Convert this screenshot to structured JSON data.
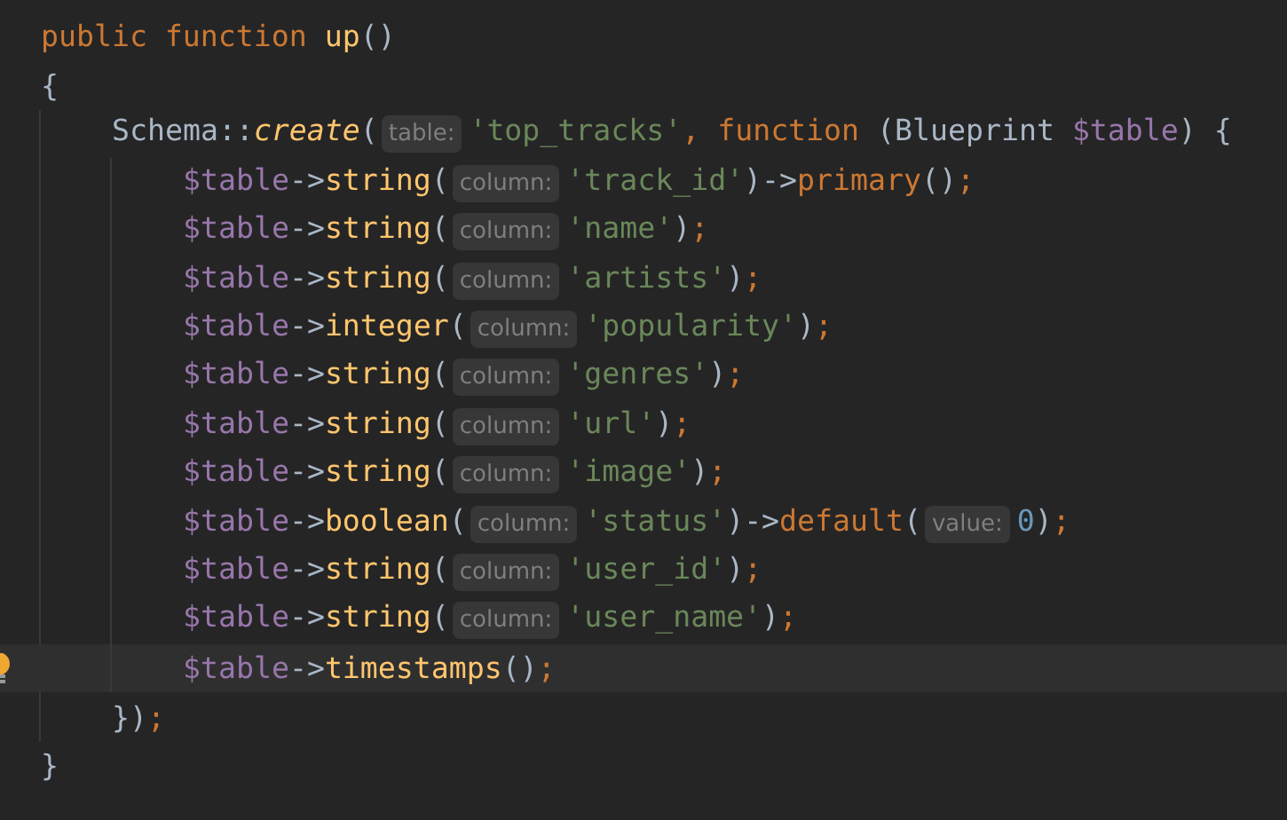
{
  "editor": {
    "lines": [
      {
        "current": false,
        "tokens": [
          {
            "kind": "keyword",
            "text": "public function"
          },
          {
            "kind": "function",
            "text": "up"
          },
          {
            "kind": "punct",
            "text": "()"
          }
        ]
      },
      {
        "current": false,
        "tokens": [
          {
            "kind": "punct",
            "text": "{"
          }
        ],
        "children": [
          {
            "current": false,
            "tokens": [
              {
                "kind": "class",
                "text": "Schema::"
              },
              {
                "kind": "static",
                "text": "create"
              },
              {
                "kind": "punct",
                "text": "("
              },
              {
                "kind": "hint",
                "text": "table:"
              },
              {
                "kind": "string",
                "text": "'top_tracks'"
              },
              {
                "kind": "separator",
                "text": ","
              },
              {
                "kind": "keyword",
                "text": "function"
              },
              {
                "kind": "punct",
                "text": "(Blueprint"
              },
              {
                "kind": "variable",
                "text": "$table"
              },
              {
                "kind": "punct",
                "text": ") {"
              }
            ],
            "children": [
              {
                "current": false,
                "tokens": [
                  {
                    "kind": "variable",
                    "text": "$table"
                  },
                  {
                    "kind": "arrow",
                    "text": "->"
                  },
                  {
                    "kind": "method",
                    "text": "string"
                  },
                  {
                    "kind": "punct",
                    "text": "("
                  },
                  {
                    "kind": "hint",
                    "text": "column:"
                  },
                  {
                    "kind": "string",
                    "text": "'track_id'"
                  },
                  {
                    "kind": "punct",
                    "text": ")"
                  },
                  {
                    "kind": "arrow",
                    "text": "->"
                  },
                  {
                    "kind": "chained",
                    "text": "primary"
                  },
                  {
                    "kind": "punct",
                    "text": "()"
                  },
                  {
                    "kind": "separator",
                    "text": ";"
                  }
                ]
              },
              {
                "current": false,
                "tokens": [
                  {
                    "kind": "variable",
                    "text": "$table"
                  },
                  {
                    "kind": "arrow",
                    "text": "->"
                  },
                  {
                    "kind": "method",
                    "text": "string"
                  },
                  {
                    "kind": "punct",
                    "text": "("
                  },
                  {
                    "kind": "hint",
                    "text": "column:"
                  },
                  {
                    "kind": "string",
                    "text": "'name'"
                  },
                  {
                    "kind": "punct",
                    "text": ")"
                  },
                  {
                    "kind": "separator",
                    "text": ";"
                  }
                ]
              },
              {
                "current": false,
                "tokens": [
                  {
                    "kind": "variable",
                    "text": "$table"
                  },
                  {
                    "kind": "arrow",
                    "text": "->"
                  },
                  {
                    "kind": "method",
                    "text": "string"
                  },
                  {
                    "kind": "punct",
                    "text": "("
                  },
                  {
                    "kind": "hint",
                    "text": "column:"
                  },
                  {
                    "kind": "string",
                    "text": "'artists'"
                  },
                  {
                    "kind": "punct",
                    "text": ")"
                  },
                  {
                    "kind": "separator",
                    "text": ";"
                  }
                ]
              },
              {
                "current": false,
                "tokens": [
                  {
                    "kind": "variable",
                    "text": "$table"
                  },
                  {
                    "kind": "arrow",
                    "text": "->"
                  },
                  {
                    "kind": "method",
                    "text": "integer"
                  },
                  {
                    "kind": "punct",
                    "text": "("
                  },
                  {
                    "kind": "hint",
                    "text": "column:"
                  },
                  {
                    "kind": "string",
                    "text": "'popularity'"
                  },
                  {
                    "kind": "punct",
                    "text": ")"
                  },
                  {
                    "kind": "separator",
                    "text": ";"
                  }
                ]
              },
              {
                "current": false,
                "tokens": [
                  {
                    "kind": "variable",
                    "text": "$table"
                  },
                  {
                    "kind": "arrow",
                    "text": "->"
                  },
                  {
                    "kind": "method",
                    "text": "string"
                  },
                  {
                    "kind": "punct",
                    "text": "("
                  },
                  {
                    "kind": "hint",
                    "text": "column:"
                  },
                  {
                    "kind": "string",
                    "text": "'genres'"
                  },
                  {
                    "kind": "punct",
                    "text": ")"
                  },
                  {
                    "kind": "separator",
                    "text": ";"
                  }
                ]
              },
              {
                "current": false,
                "tokens": [
                  {
                    "kind": "variable",
                    "text": "$table"
                  },
                  {
                    "kind": "arrow",
                    "text": "->"
                  },
                  {
                    "kind": "method",
                    "text": "string"
                  },
                  {
                    "kind": "punct",
                    "text": "("
                  },
                  {
                    "kind": "hint",
                    "text": "column:"
                  },
                  {
                    "kind": "string",
                    "text": "'url'"
                  },
                  {
                    "kind": "punct",
                    "text": ")"
                  },
                  {
                    "kind": "separator",
                    "text": ";"
                  }
                ]
              },
              {
                "current": false,
                "tokens": [
                  {
                    "kind": "variable",
                    "text": "$table"
                  },
                  {
                    "kind": "arrow",
                    "text": "->"
                  },
                  {
                    "kind": "method",
                    "text": "string"
                  },
                  {
                    "kind": "punct",
                    "text": "("
                  },
                  {
                    "kind": "hint",
                    "text": "column:"
                  },
                  {
                    "kind": "string",
                    "text": "'image'"
                  },
                  {
                    "kind": "punct",
                    "text": ")"
                  },
                  {
                    "kind": "separator",
                    "text": ";"
                  }
                ]
              },
              {
                "current": false,
                "tokens": [
                  {
                    "kind": "variable",
                    "text": "$table"
                  },
                  {
                    "kind": "arrow",
                    "text": "->"
                  },
                  {
                    "kind": "method",
                    "text": "boolean"
                  },
                  {
                    "kind": "punct",
                    "text": "("
                  },
                  {
                    "kind": "hint",
                    "text": "column:"
                  },
                  {
                    "kind": "string",
                    "text": "'status'"
                  },
                  {
                    "kind": "punct",
                    "text": ")"
                  },
                  {
                    "kind": "arrow",
                    "text": "->"
                  },
                  {
                    "kind": "chained",
                    "text": "default"
                  },
                  {
                    "kind": "punct",
                    "text": "("
                  },
                  {
                    "kind": "hint",
                    "text": "value:"
                  },
                  {
                    "kind": "number",
                    "text": "0"
                  },
                  {
                    "kind": "punct",
                    "text": ")"
                  },
                  {
                    "kind": "separator",
                    "text": ";"
                  }
                ]
              },
              {
                "current": false,
                "tokens": [
                  {
                    "kind": "variable",
                    "text": "$table"
                  },
                  {
                    "kind": "arrow",
                    "text": "->"
                  },
                  {
                    "kind": "method",
                    "text": "string"
                  },
                  {
                    "kind": "punct",
                    "text": "("
                  },
                  {
                    "kind": "hint",
                    "text": "column:"
                  },
                  {
                    "kind": "string",
                    "text": "'user_id'"
                  },
                  {
                    "kind": "punct",
                    "text": ")"
                  },
                  {
                    "kind": "separator",
                    "text": ";"
                  }
                ]
              },
              {
                "current": false,
                "tokens": [
                  {
                    "kind": "variable",
                    "text": "$table"
                  },
                  {
                    "kind": "arrow",
                    "text": "->"
                  },
                  {
                    "kind": "method",
                    "text": "string"
                  },
                  {
                    "kind": "punct",
                    "text": "("
                  },
                  {
                    "kind": "hint",
                    "text": "column:"
                  },
                  {
                    "kind": "string",
                    "text": "'user_name'"
                  },
                  {
                    "kind": "punct",
                    "text": ")"
                  },
                  {
                    "kind": "separator",
                    "text": ";"
                  }
                ]
              },
              {
                "current": true,
                "tokens": [
                  {
                    "kind": "variable",
                    "text": "$table"
                  },
                  {
                    "kind": "arrow",
                    "text": "->"
                  },
                  {
                    "kind": "method",
                    "text": "timestamps"
                  },
                  {
                    "kind": "punct",
                    "text": "()"
                  },
                  {
                    "kind": "separator",
                    "text": ";"
                  }
                ]
              }
            ]
          },
          {
            "current": false,
            "tokens": [
              {
                "kind": "punct",
                "text": "})"
              },
              {
                "kind": "separator",
                "text": ";"
              }
            ]
          }
        ]
      },
      {
        "current": false,
        "tokens": [
          {
            "kind": "punct",
            "text": "}"
          }
        ]
      }
    ]
  }
}
